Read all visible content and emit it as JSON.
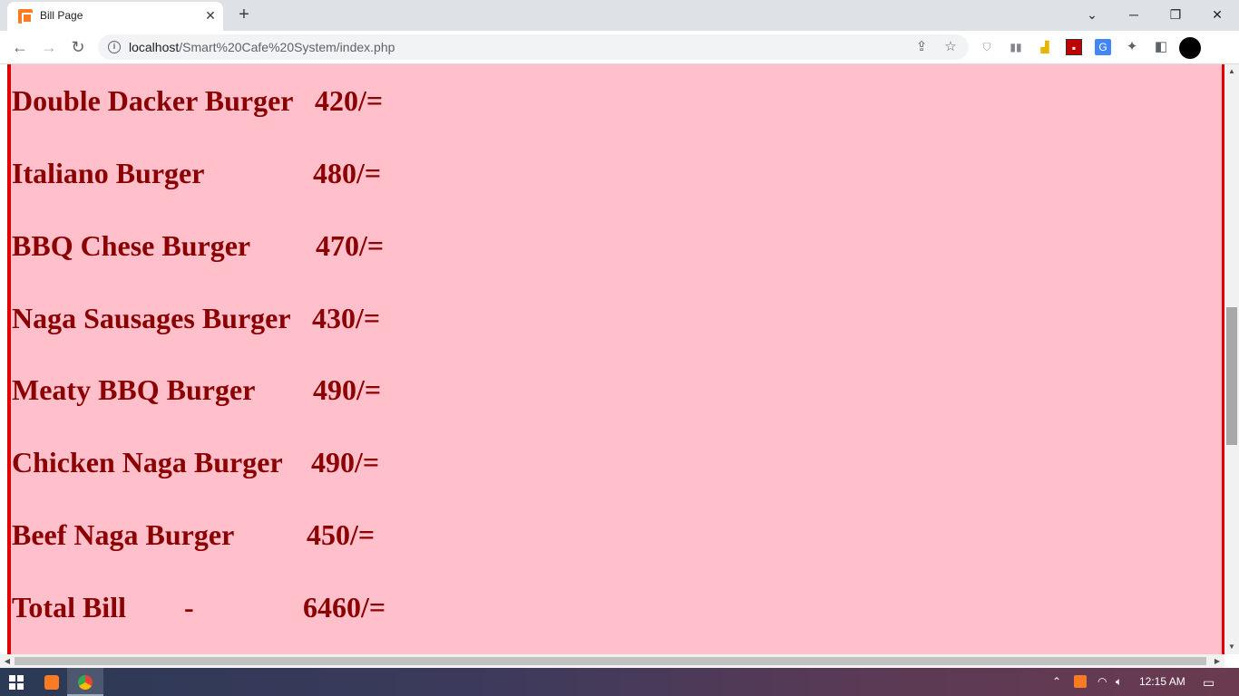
{
  "browser": {
    "tab_title": "Bill Page",
    "url_host": "localhost",
    "url_path": "/Smart%20Cafe%20System/index.php"
  },
  "bill": {
    "items": [
      {
        "name": "Double Dacker Burger",
        "price": "420/="
      },
      {
        "name": "Italiano Burger",
        "price": "480/="
      },
      {
        "name": "BBQ Chese Burger",
        "price": "470/="
      },
      {
        "name": "Naga Sausages Burger",
        "price": "430/="
      },
      {
        "name": "Meaty BBQ Burger",
        "price": "490/="
      },
      {
        "name": "Chicken Naga Burger",
        "price": "490/="
      },
      {
        "name": "Beef Naga Burger",
        "price": "450/="
      }
    ],
    "total_label": "Total Bill",
    "total_separator": "-",
    "total_value": "6460/="
  },
  "colors": {
    "page_bg": "#ffc0cb",
    "text": "#8b0000",
    "border": "#e00000"
  },
  "taskbar": {
    "time": "12:15 AM"
  }
}
